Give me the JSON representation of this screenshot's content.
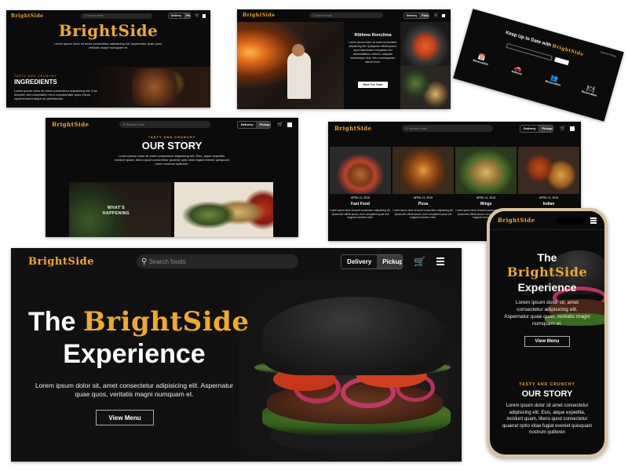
{
  "brand": {
    "name": "BrightSide",
    "name_prefix": "Bright",
    "name_suffix": "Side"
  },
  "colors": {
    "accent": "#f0a92a",
    "dark": "#0b0b0b"
  },
  "nav": {
    "search_placeholder": "Search foods",
    "delivery_label": "Delivery",
    "pickup_label": "Pickup",
    "cart_icon": "cart-icon",
    "menu_icon": "hamburger-icon"
  },
  "card1": {
    "hero_line": "Lorem ipsum dolor sit amet consectetur adipisicing elit. Aspernatur quae quos, veritatis magni numquam et.",
    "eyebrow": "TASTY AND CRUNCHY",
    "heading": "INGREDIENTS",
    "body": "Lorem ipsum dolor sit amet consectetur adipisicing elit. Eius dolorem sint voluptatem error repudiandae quos minus reprehenderit atque ad perferendis."
  },
  "card2": {
    "title": "Ritthmo Ronclima",
    "body": "Lorem ipsum dolor sit amet consectetur adipisicing elit. Quisquam officiis ipsum, quod laboriosam voluptates nisi necessitatibus minima, voluptate doloremque eius. Vero consequuntur labore enim.",
    "button": "Meet The Team"
  },
  "card3": {
    "title_prefix": "Keep Up to Date with",
    "title_suffix": "BrightSide",
    "features": [
      {
        "label": "Reservation",
        "icon": "calendar-icon"
      },
      {
        "label": "Delivery",
        "icon": "car-icon"
      },
      {
        "label": "Reservation",
        "icon": "people-icon"
      },
      {
        "label": "Reservation",
        "icon": "dish-icon"
      }
    ]
  },
  "card4": {
    "eyebrow": "TASTY AND CRUNCHY",
    "heading": "OUR STORY",
    "body": "Lorem ipsum dolor sit amet consectetur adipisicing elit. Eius, atque expedita, incidunt quam, libero quod consectetur quaerat optio vitae fugiat eveniet quisquam nemo nostrum quilloren.",
    "happening": "WHAT'S HAPPENING"
  },
  "card5": {
    "items": [
      {
        "date": "APRIL 11, 2016",
        "title": "Fast Food",
        "body": "Lorem ipsum dolor sit amet consectetur adipisicing elit. Quosomet officiis ipsum, ea in voluptatem quae sint magnam dolorem enim."
      },
      {
        "date": "APRIL 11, 2016",
        "title": "Pizza",
        "body": "Lorem ipsum dolor sit amet consectetur adipisicing elit. Quosomet officiis ipsum, ea in voluptatem quae sint magnam dolorem enim."
      },
      {
        "date": "APRIL 11, 2016",
        "title": "Wings",
        "body": "Lorem ipsum dolor sit amet consectetur adipisicing elit. Quosomet officiis ipsum, ea in voluptatem quae sint magnam dolorem enim."
      },
      {
        "date": "APRIL 11, 2016",
        "title": "Indian",
        "body": "Lorem ipsum dolor sit amet consectetur adipisicing elit. Quosomet officiis ipsum, ea in voluptatem quae sint magnam dolorem enim."
      }
    ]
  },
  "main": {
    "headline_the": "The",
    "headline_brand": "BrightSide",
    "headline_exp": "Experience",
    "subtext": "Lorem ipsum dolor sit, amet consectetur adipisicing elit. Aspernatur quae quos, veritatis magni numquam et.",
    "cta": "View Menu"
  },
  "phone": {
    "headline_the": "The",
    "headline_brand": "BrightSide",
    "headline_exp": "Experience",
    "subtext": "Lorem ipsum dolor sit, amet consectetur adipisicing elit. Aspernatur quae quos, veritatis magni numquam et.",
    "cta": "View Menu",
    "eyebrow": "TASTY AND CRUNCHY",
    "heading": "OUR STORY",
    "body": "Lorem ipsum dolor sit amet consectetur adipisicing elit. Eius, atque expedita, incidunt quam, libero quod consectetur quaerat optio vitae fugiat eveniet quisquam nostrum quilloren"
  }
}
